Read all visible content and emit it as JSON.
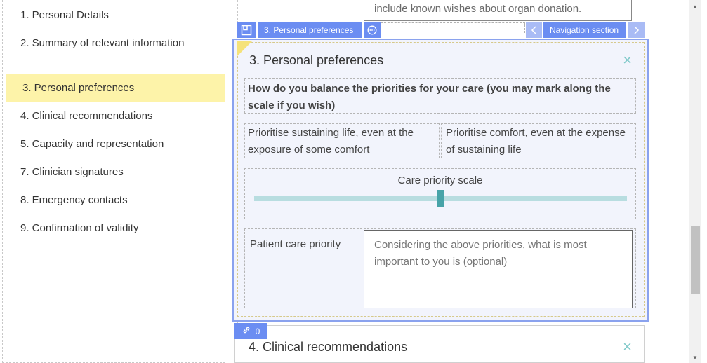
{
  "sidebar": {
    "items": [
      {
        "label": "1. Personal Details"
      },
      {
        "label": "2. Summary of relevant information"
      },
      {
        "label": "3. Personal preferences",
        "active": true
      },
      {
        "label": "4. Clinical recommendations"
      },
      {
        "label": "5. Capacity and representation"
      },
      {
        "label": "7. Clinician signatures"
      },
      {
        "label": "8. Emergency contacts"
      },
      {
        "label": "9. Confirmation of validity"
      }
    ]
  },
  "previous_field": {
    "text": "include known wishes about organ donation."
  },
  "toolbar": {
    "section_label": "3. Personal preferences",
    "navigation_label": "Navigation section"
  },
  "section": {
    "title": "3. Personal preferences",
    "close_symbol": "×",
    "question": "How do you balance the priorities for your care (you may mark along the scale if you wish)",
    "option_left": "Prioritise sustaining life, even at the exposure of some comfort",
    "option_right": "Prioritise comfort, even at the expense of sustaining life",
    "slider_label": "Care priority scale",
    "slider_value_fraction": 0.5,
    "priority_label": "Patient care priority",
    "priority_placeholder": "Considering the above priorities, what is most important to you is (optional)"
  },
  "next_section": {
    "title": "4. Clinical recommendations",
    "close_symbol": "×",
    "link_count": "0"
  },
  "colors": {
    "accent_blue": "#6b8df2",
    "active_nav": "#fdf3a9",
    "slider_thumb": "#47a3a8",
    "slider_track": "#b8dde0",
    "close_icon": "#7fc9c9"
  },
  "icons": {
    "section_type": "layout-icon",
    "more_options": "ellipsis-circle-icon",
    "prev": "chevron-left-icon",
    "next": "chevron-right-icon",
    "link": "link-icon",
    "close": "close-icon"
  }
}
